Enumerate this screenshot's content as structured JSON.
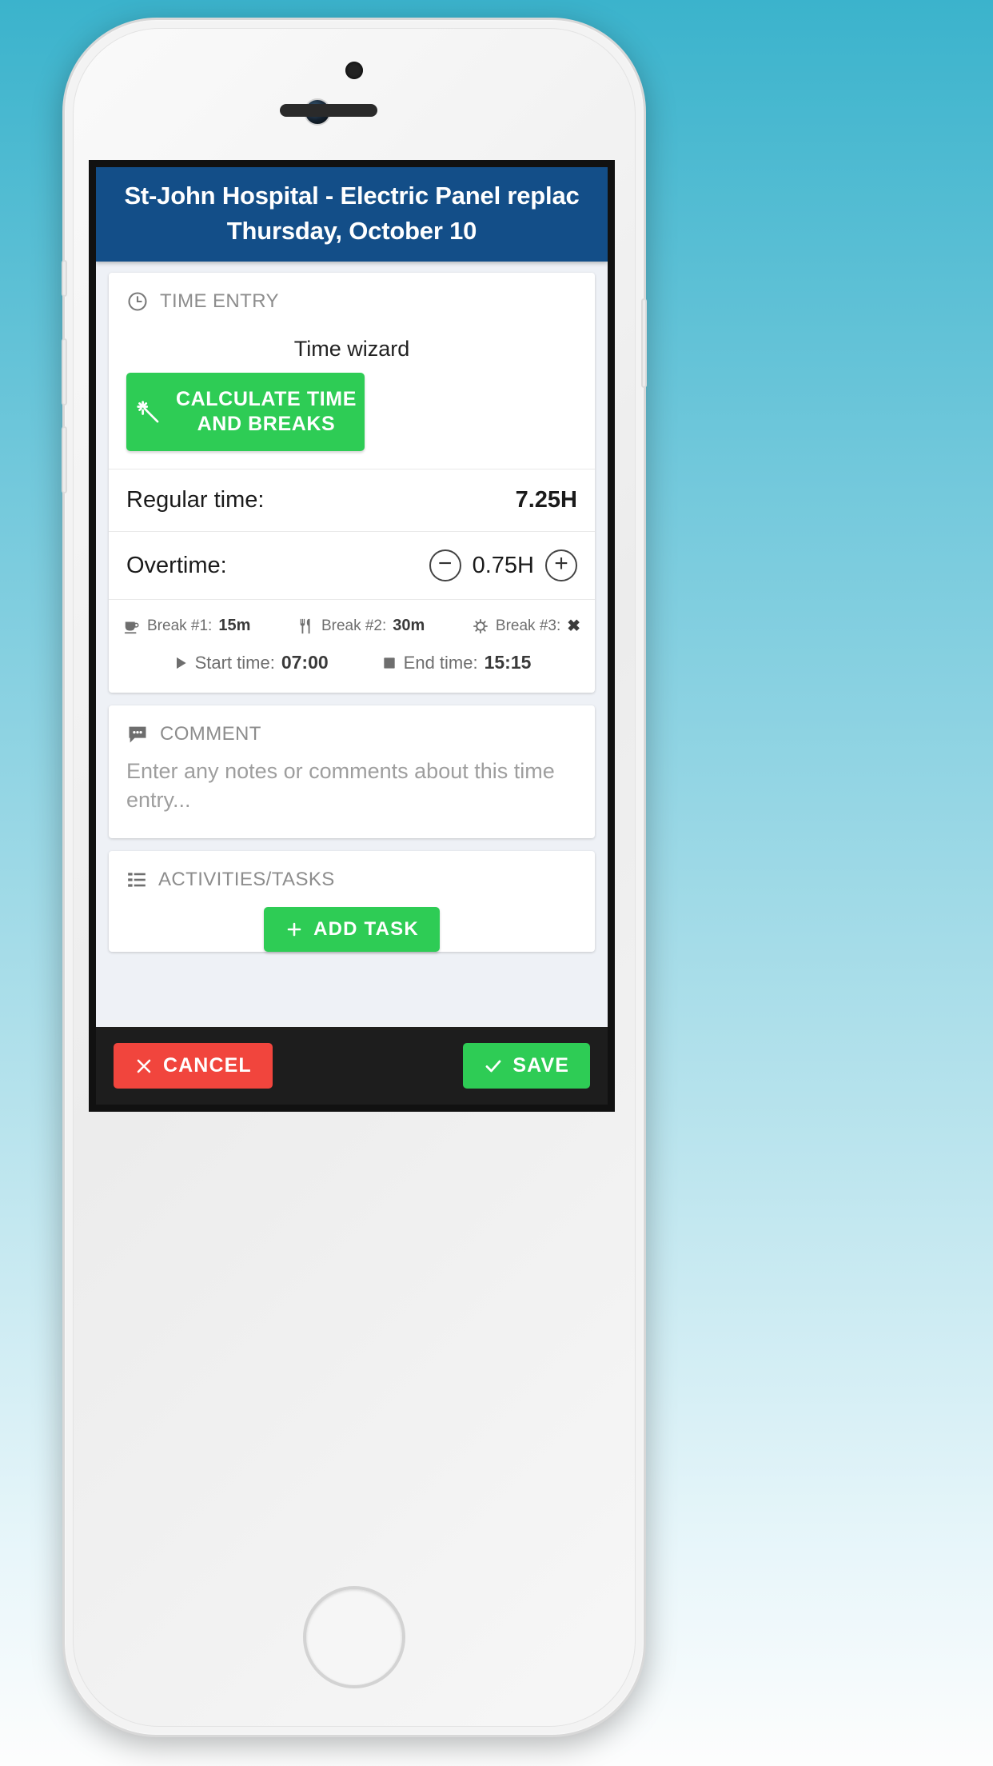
{
  "device": {
    "name": "iphone-mockup",
    "camera_icon": "camera-icon",
    "speaker_icon": "earpiece-speaker",
    "home_button_icon": "home-button"
  },
  "header": {
    "title": "St-John Hospital - Electric Panel replac",
    "subtitle": "Thursday, October 10",
    "background_color": "#134e88"
  },
  "time_entry": {
    "section_label": "TIME ENTRY",
    "section_icon": "clock-icon",
    "wizard_label": "Time wizard",
    "calculate_button": {
      "label_line1": "CALCULATE TIME",
      "label_line2": "AND BREAKS",
      "icon": "magic-wand-icon",
      "color": "#2ecc55"
    },
    "regular_time": {
      "label": "Regular time:",
      "value": "7.25H"
    },
    "overtime": {
      "label": "Overtime:",
      "value": "0.75H",
      "decrement_label": "−",
      "increment_label": "+"
    },
    "breaks": [
      {
        "icon": "coffee-cup-icon",
        "label": "Break #1:",
        "value": "15m"
      },
      {
        "icon": "fork-knife-icon",
        "label": "Break #2:",
        "value": "30m"
      },
      {
        "icon": "gear-icon",
        "label": "Break #3:",
        "value": "✖"
      }
    ],
    "start_time": {
      "icon": "play-triangle-icon",
      "label": "Start time:",
      "value": "07:00"
    },
    "end_time": {
      "icon": "stop-square-icon",
      "label": "End time:",
      "value": "15:15"
    }
  },
  "comment": {
    "section_label": "COMMENT",
    "section_icon": "speech-bubble-icon",
    "placeholder": "Enter any notes or comments about this time entry...",
    "value": ""
  },
  "activities": {
    "section_label": "ACTIVITIES/TASKS",
    "section_icon": "list-icon",
    "add_task_button": {
      "label": "ADD TASK",
      "icon": "plus-icon",
      "color": "#2ecc55"
    }
  },
  "footer": {
    "cancel_button": {
      "label": "CANCEL",
      "icon": "x-icon",
      "color": "#f1453d"
    },
    "save_button": {
      "label": "SAVE",
      "icon": "check-icon",
      "color": "#2ecc55"
    }
  }
}
